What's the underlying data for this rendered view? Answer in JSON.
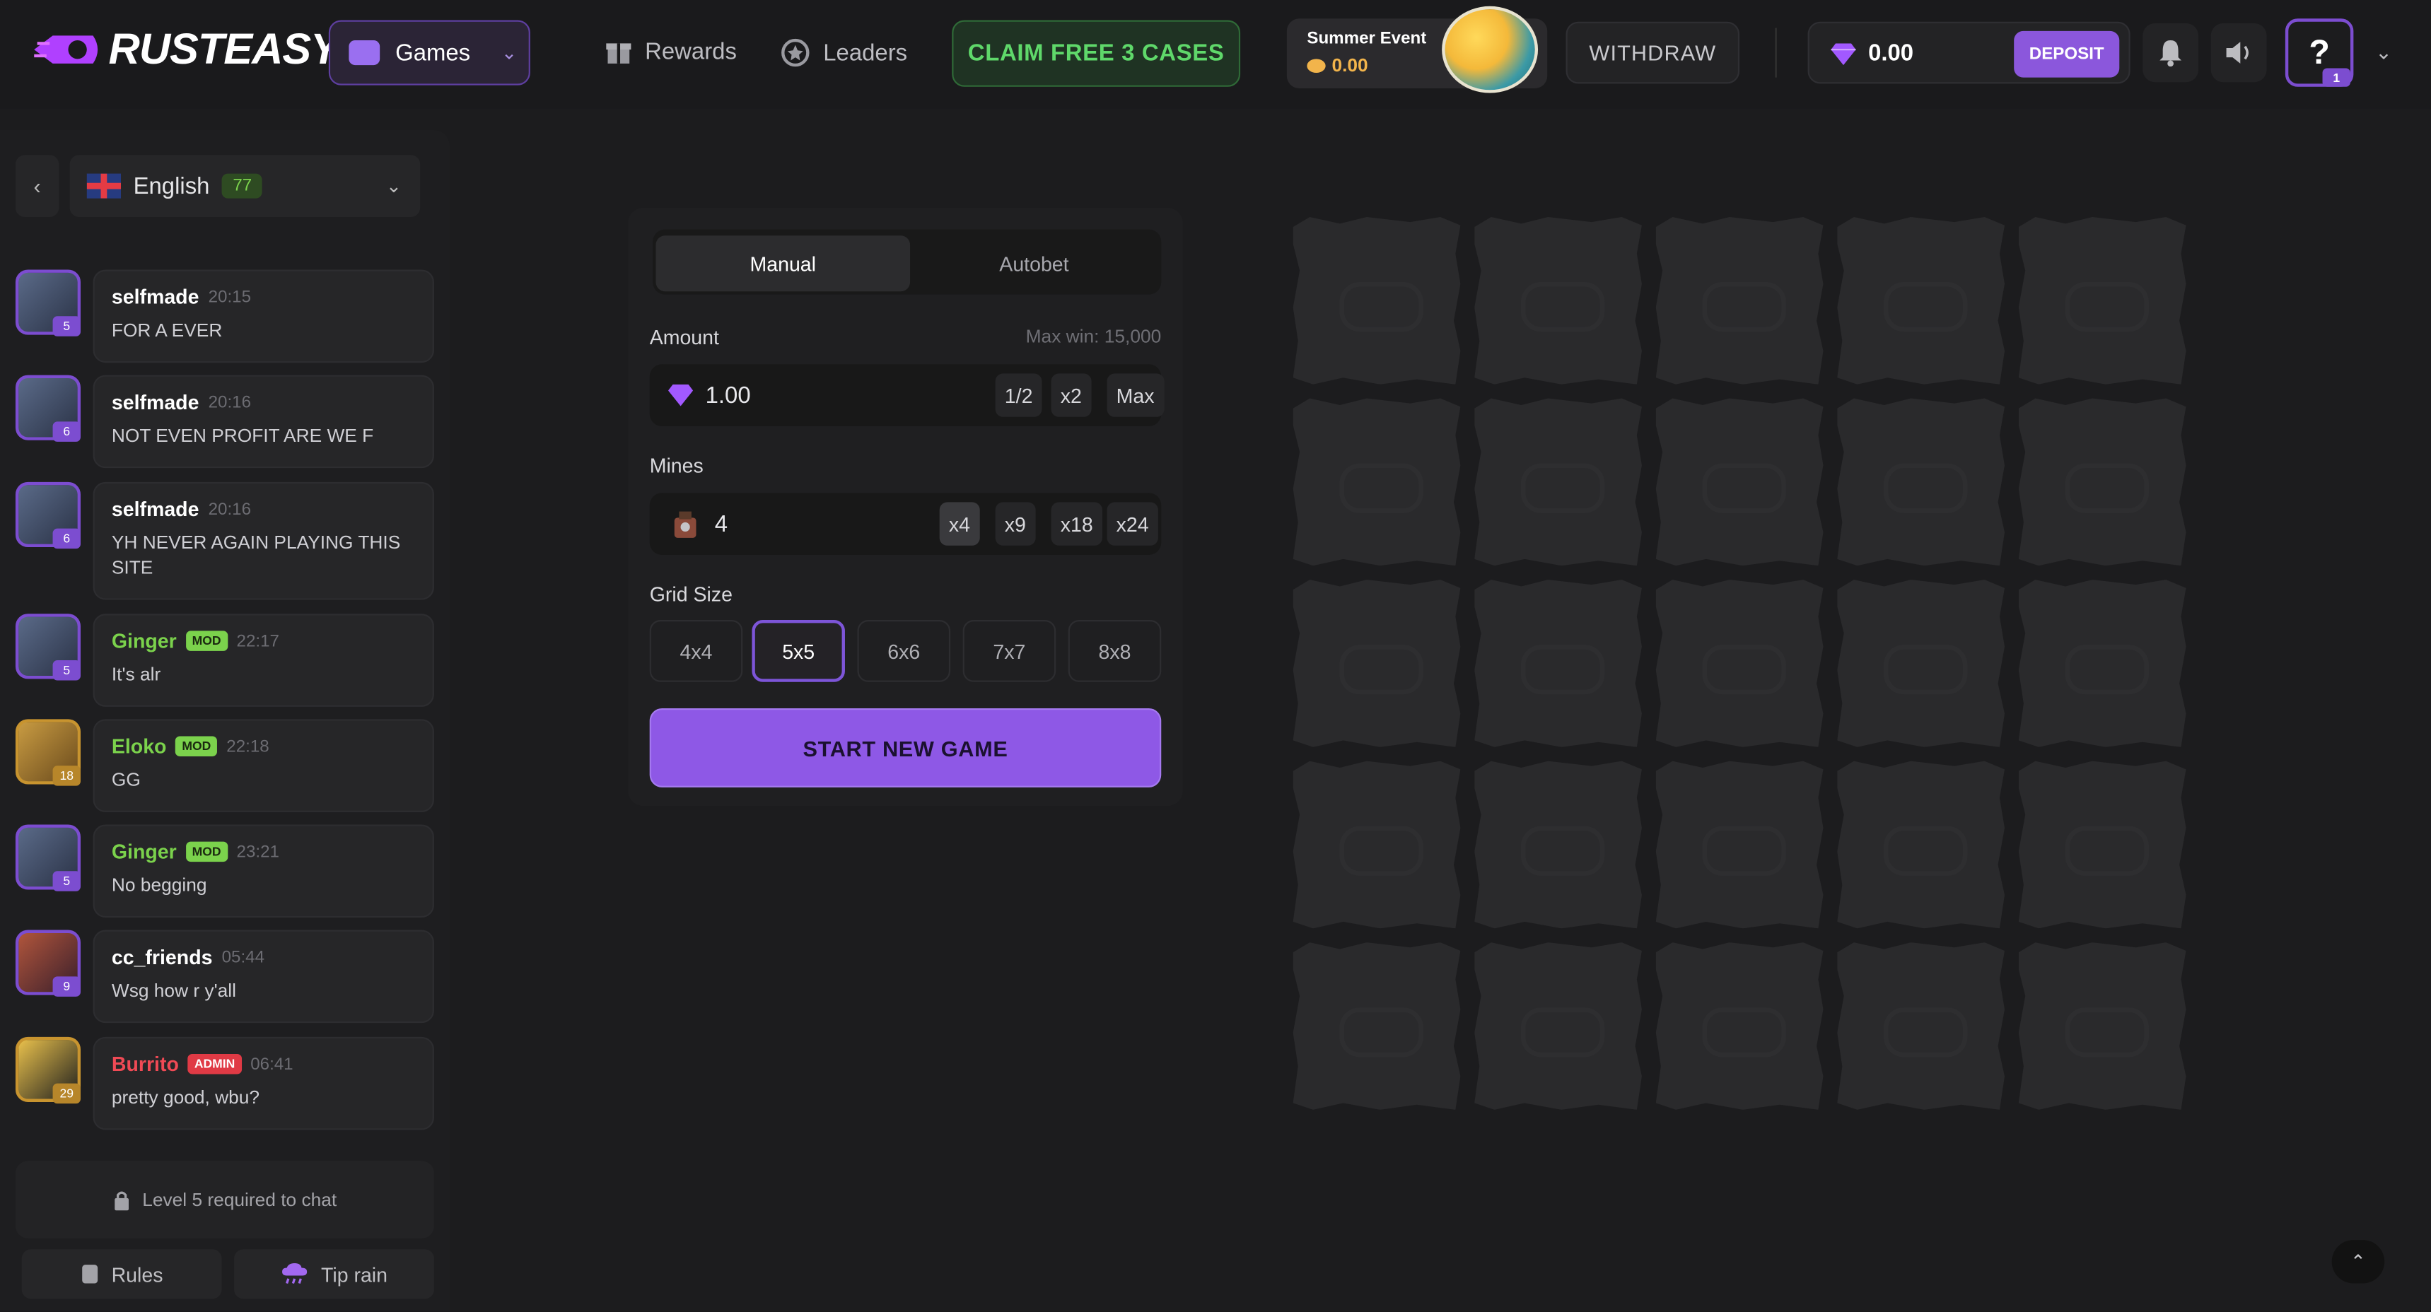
{
  "header": {
    "logo_text": "RUSTEASY",
    "games_label": "Games",
    "nav": [
      {
        "label": "Rewards",
        "icon": "gift-icon"
      },
      {
        "label": "Leaders",
        "icon": "star-badge-icon"
      }
    ],
    "claim_label": "CLAIM FREE 3 CASES",
    "event_title": "Summer Event",
    "event_value": "0.00",
    "withdraw_label": "WITHDRAW",
    "balance": "0.00",
    "deposit_label": "DEPOSIT",
    "help_badge": "1",
    "accent": "#8b57dc"
  },
  "sidebar": {
    "language": "English",
    "online_count": "77",
    "messages": [
      {
        "user": "selfmade",
        "time": "20:15",
        "text": "FOR A EVER",
        "level": "5",
        "role": ""
      },
      {
        "user": "selfmade",
        "time": "20:16",
        "text": "NOT EVEN PROFIT ARE WE F",
        "level": "6",
        "role": ""
      },
      {
        "user": "selfmade",
        "time": "20:16",
        "text": "YH NEVER AGAIN PLAYING THIS SITE",
        "level": "6",
        "role": ""
      },
      {
        "user": "Ginger",
        "time": "22:17",
        "text": "It's alr",
        "level": "5",
        "role": "MOD"
      },
      {
        "user": "Eloko",
        "time": "22:18",
        "text": "GG",
        "level": "18",
        "role": "MOD"
      },
      {
        "user": "Ginger",
        "time": "23:21",
        "text": "No begging",
        "level": "5",
        "role": "MOD"
      },
      {
        "user": "cc_friends",
        "time": "05:44",
        "text": "Wsg how r y'all",
        "level": "9",
        "role": ""
      },
      {
        "user": "Burrito",
        "time": "06:41",
        "text": "pretty good, wbu?",
        "level": "29",
        "role": "ADMIN"
      }
    ],
    "chat_lock": "Level 5 required to chat",
    "rules_label": "Rules",
    "tip_rain_label": "Tip rain"
  },
  "panel": {
    "tabs": [
      "Manual",
      "Autobet"
    ],
    "amount_label": "Amount",
    "max_win": "Max win: 15,000",
    "amount_value": "1.00",
    "amount_chips": [
      "1/2",
      "x2",
      "Max"
    ],
    "mines_label": "Mines",
    "mines_value": "4",
    "mines_chips": [
      "x4",
      "x9",
      "x18",
      "x24"
    ],
    "grid_label": "Grid Size",
    "grid_options": [
      "4x4",
      "5x5",
      "6x6",
      "7x7",
      "8x8"
    ],
    "selected_grid": "5x5",
    "start_label": "START NEW GAME"
  },
  "board": {
    "rows": 5,
    "cols": 5
  }
}
